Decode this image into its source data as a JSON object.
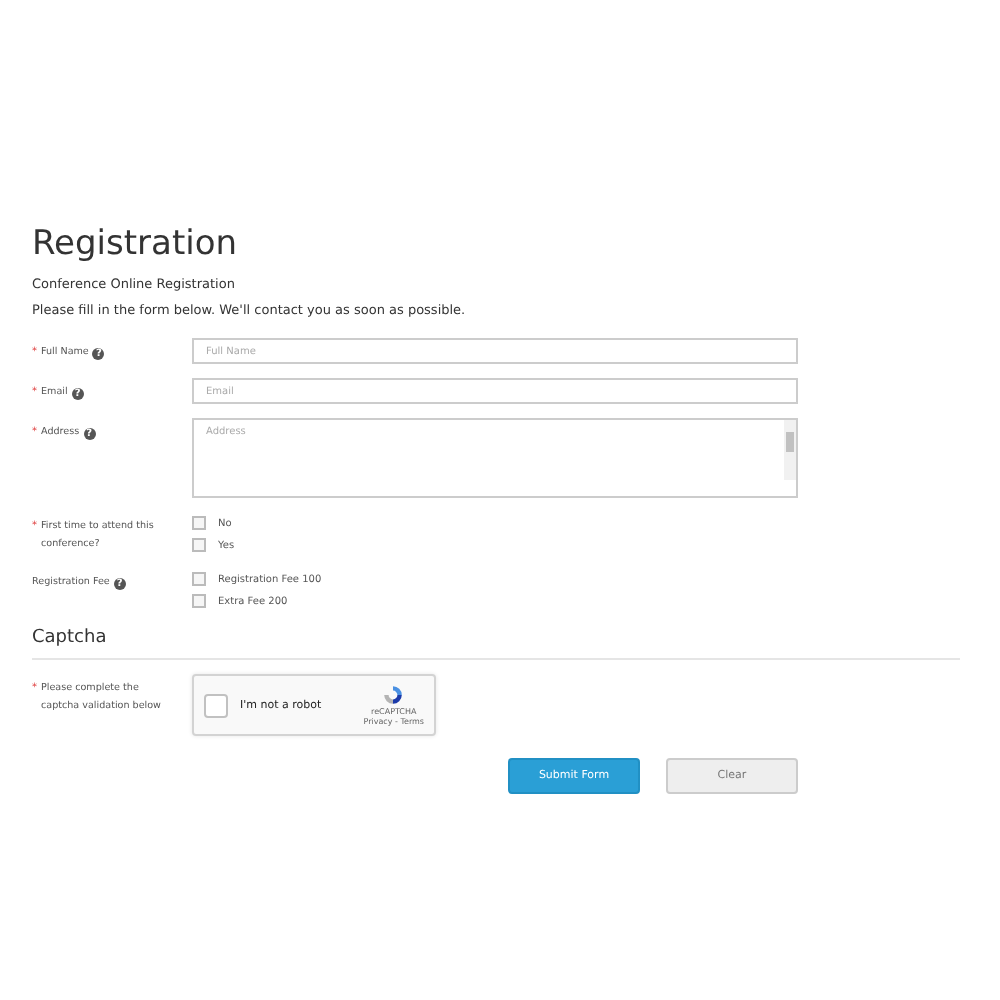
{
  "title": "Registration",
  "subtitle": "Conference Online Registration",
  "intro": "Please fill in the form below. We'll contact you as soon as possible.",
  "fields": [
    {
      "kind": "text",
      "label": "Full Name",
      "required_mark": "*",
      "help": "?",
      "placeholder": "Full Name"
    },
    {
      "kind": "text",
      "label": "Email",
      "required_mark": "*",
      "help": "?",
      "placeholder": "Email"
    },
    {
      "kind": "textarea",
      "label": "Address",
      "required_mark": "*",
      "help": "?",
      "placeholder": "Address"
    },
    {
      "kind": "choices",
      "label": "First time to attend this conference?",
      "required_mark": "*",
      "options": [
        {
          "label": "No",
          "checked": false
        },
        {
          "label": "Yes",
          "checked": false
        }
      ]
    },
    {
      "kind": "choices",
      "label": "Registration Fee",
      "help": "?",
      "options": [
        {
          "label": "Registration Fee 100",
          "checked": false
        },
        {
          "label": "Extra Fee 200",
          "checked": false
        }
      ]
    }
  ],
  "captcha": {
    "heading": "Captcha",
    "label": "Please complete the captcha validation below",
    "required_mark": "*",
    "checkbox_label": "I'm not a robot",
    "checked": false,
    "brand": "reCAPTCHA",
    "links": "Privacy - Terms"
  },
  "buttons": [
    {
      "kind": "primary",
      "label": "Submit Form"
    },
    {
      "kind": "secondary",
      "label": "Clear"
    }
  ]
}
